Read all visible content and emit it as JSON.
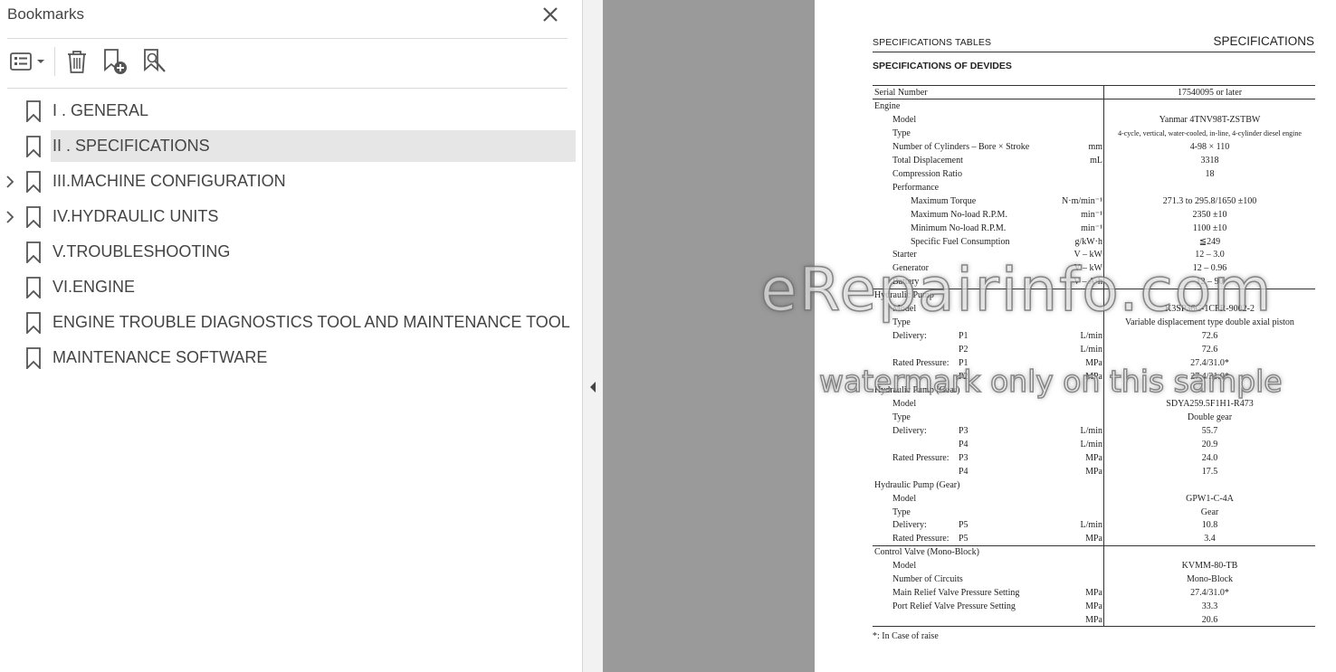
{
  "panel": {
    "title": "Bookmarks",
    "toolbar": [
      "options",
      "delete",
      "add-bookmark",
      "find-bookmark"
    ]
  },
  "bookmarks": [
    {
      "label": "I . GENERAL",
      "expandable": false,
      "selected": false
    },
    {
      "label": "II . SPECIFICATIONS",
      "expandable": false,
      "selected": true
    },
    {
      "label": "III.MACHINE CONFIGURATION",
      "expandable": true,
      "selected": false
    },
    {
      "label": "IV.HYDRAULIC UNITS",
      "expandable": true,
      "selected": false
    },
    {
      "label": "V.TROUBLESHOOTING",
      "expandable": false,
      "selected": false
    },
    {
      "label": "VI.ENGINE",
      "expandable": false,
      "selected": false
    },
    {
      "label": "ENGINE TROUBLE DIAGNOSTICS TOOL AND MAINTENANCE TOOL",
      "expandable": false,
      "selected": false
    },
    {
      "label": "MAINTENANCE SOFTWARE",
      "expandable": false,
      "selected": false
    }
  ],
  "document": {
    "header_left": "SPECIFICATIONS TABLES",
    "header_right": "SPECIFICATIONS",
    "subtitle": "SPECIFICATIONS OF DEVIDES",
    "serial_label": "Serial Number",
    "serial_value": "17540095 or later",
    "rows": [
      {
        "label": "Engine",
        "level": 0,
        "sub": "",
        "unit": "",
        "value": ""
      },
      {
        "label": "Model",
        "level": 1,
        "sub": "",
        "unit": "",
        "value": "Yanmar 4TNV98T-ZSTBW"
      },
      {
        "label": "Type",
        "level": 1,
        "sub": "",
        "unit": "",
        "value": "4-cycle, vertical, water-cooled, in-line, 4-cylinder diesel engine",
        "small": true
      },
      {
        "label": "Number of Cylinders – Bore × Stroke",
        "level": 1,
        "sub": "",
        "unit": "mm",
        "value": "4-98 × 110"
      },
      {
        "label": "Total Displacement",
        "level": 1,
        "sub": "",
        "unit": "mL",
        "value": "3318"
      },
      {
        "label": "Compression Ratio",
        "level": 1,
        "sub": "",
        "unit": "",
        "value": "18"
      },
      {
        "label": "Performance",
        "level": 1,
        "sub": "",
        "unit": "",
        "value": ""
      },
      {
        "label": "Maximum Torque",
        "level": 2,
        "sub": "",
        "unit": "N·m/min⁻¹",
        "value": "271.3 to 295.8/1650 ±100"
      },
      {
        "label": "Maximum No-load R.P.M.",
        "level": 2,
        "sub": "",
        "unit": "min⁻¹",
        "value": "2350 ±10"
      },
      {
        "label": "Minimum No-load R.P.M.",
        "level": 2,
        "sub": "",
        "unit": "min⁻¹",
        "value": "1100 ±10"
      },
      {
        "label": "Specific Fuel Consumption",
        "level": 2,
        "sub": "",
        "unit": "g/kW·h",
        "value": "≦249"
      },
      {
        "label": "Starter",
        "level": 1,
        "sub": "",
        "unit": "V – kW",
        "value": "12 – 3.0"
      },
      {
        "label": "Generator",
        "level": 1,
        "sub": "",
        "unit": "V – kW",
        "value": "12 – 0.96"
      },
      {
        "label": "Battery",
        "level": 1,
        "sub": "",
        "unit": "V – A·h",
        "value": "12 – 90"
      },
      {
        "label": "Hydraulic Pump",
        "level": 0,
        "sub": "",
        "unit": "",
        "value": ""
      },
      {
        "label": "Model",
        "level": 1,
        "sub": "",
        "unit": "",
        "value": "K3SP36C-1CFR-9002-2"
      },
      {
        "label": "Type",
        "level": 1,
        "sub": "",
        "unit": "",
        "value": "Variable displacement type double axial piston"
      },
      {
        "label": "Delivery:",
        "level": 1,
        "sub": "P1",
        "unit": "L/min",
        "value": "72.6"
      },
      {
        "label": "",
        "level": 1,
        "sub": "P2",
        "unit": "L/min",
        "value": "72.6"
      },
      {
        "label": "Rated Pressure:",
        "level": 1,
        "sub": "P1",
        "unit": "MPa",
        "value": "27.4/31.0*"
      },
      {
        "label": "",
        "level": 1,
        "sub": "P2",
        "unit": "MPa",
        "value": "27.4/31.0*"
      },
      {
        "label": "Hydraulic Pump (Gear)",
        "level": 0,
        "sub": "",
        "unit": "",
        "value": ""
      },
      {
        "label": "Model",
        "level": 1,
        "sub": "",
        "unit": "",
        "value": "SDYA259.5F1H1-R473"
      },
      {
        "label": "Type",
        "level": 1,
        "sub": "",
        "unit": "",
        "value": "Double gear"
      },
      {
        "label": "Delivery:",
        "level": 1,
        "sub": "P3",
        "unit": "L/min",
        "value": "55.7"
      },
      {
        "label": "",
        "level": 1,
        "sub": "P4",
        "unit": "L/min",
        "value": "20.9"
      },
      {
        "label": "Rated Pressure:",
        "level": 1,
        "sub": "P3",
        "unit": "MPa",
        "value": "24.0"
      },
      {
        "label": "",
        "level": 1,
        "sub": "P4",
        "unit": "MPa",
        "value": "17.5"
      },
      {
        "label": "Hydraulic Pump (Gear)",
        "level": 0,
        "sub": "",
        "unit": "",
        "value": ""
      },
      {
        "label": "Model",
        "level": 1,
        "sub": "",
        "unit": "",
        "value": "GPW1-C-4A"
      },
      {
        "label": "Type",
        "level": 1,
        "sub": "",
        "unit": "",
        "value": "Gear"
      },
      {
        "label": "Delivery:",
        "level": 1,
        "sub": "P5",
        "unit": "L/min",
        "value": "10.8"
      },
      {
        "label": "Rated Pressure:",
        "level": 1,
        "sub": "P5",
        "unit": "MPa",
        "value": "3.4"
      },
      {
        "label": "Control Valve (Mono-Block)",
        "level": 0,
        "sub": "",
        "unit": "",
        "value": ""
      },
      {
        "label": "Model",
        "level": 1,
        "sub": "",
        "unit": "",
        "value": "KVMM-80-TB"
      },
      {
        "label": "Number of Circuits",
        "level": 1,
        "sub": "",
        "unit": "",
        "value": "Mono-Block"
      },
      {
        "label": "Main Relief Valve Pressure Setting",
        "level": 1,
        "sub": "",
        "unit": "MPa",
        "value": "27.4/31.0*"
      },
      {
        "label": "Port Relief Valve Pressure Setting",
        "level": 1,
        "sub": "",
        "unit": "MPa",
        "value": "33.3"
      },
      {
        "label": "",
        "level": 1,
        "sub": "",
        "unit": "MPa",
        "value": "20.6"
      }
    ],
    "footnote": "*: In Case of raise"
  },
  "watermark": {
    "line1": "eRepairinfo.com",
    "line2": "watermark only on this sample"
  }
}
